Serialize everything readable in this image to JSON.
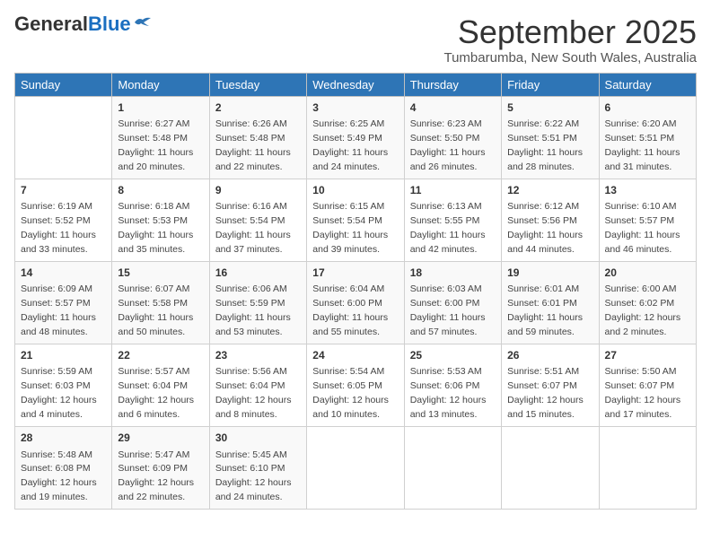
{
  "logo": {
    "general": "General",
    "blue": "Blue"
  },
  "title": "September 2025",
  "subtitle": "Tumbarumba, New South Wales, Australia",
  "days_header": [
    "Sunday",
    "Monday",
    "Tuesday",
    "Wednesday",
    "Thursday",
    "Friday",
    "Saturday"
  ],
  "weeks": [
    [
      {
        "day": "",
        "info": ""
      },
      {
        "day": "1",
        "info": "Sunrise: 6:27 AM\nSunset: 5:48 PM\nDaylight: 11 hours\nand 20 minutes."
      },
      {
        "day": "2",
        "info": "Sunrise: 6:26 AM\nSunset: 5:48 PM\nDaylight: 11 hours\nand 22 minutes."
      },
      {
        "day": "3",
        "info": "Sunrise: 6:25 AM\nSunset: 5:49 PM\nDaylight: 11 hours\nand 24 minutes."
      },
      {
        "day": "4",
        "info": "Sunrise: 6:23 AM\nSunset: 5:50 PM\nDaylight: 11 hours\nand 26 minutes."
      },
      {
        "day": "5",
        "info": "Sunrise: 6:22 AM\nSunset: 5:51 PM\nDaylight: 11 hours\nand 28 minutes."
      },
      {
        "day": "6",
        "info": "Sunrise: 6:20 AM\nSunset: 5:51 PM\nDaylight: 11 hours\nand 31 minutes."
      }
    ],
    [
      {
        "day": "7",
        "info": "Sunrise: 6:19 AM\nSunset: 5:52 PM\nDaylight: 11 hours\nand 33 minutes."
      },
      {
        "day": "8",
        "info": "Sunrise: 6:18 AM\nSunset: 5:53 PM\nDaylight: 11 hours\nand 35 minutes."
      },
      {
        "day": "9",
        "info": "Sunrise: 6:16 AM\nSunset: 5:54 PM\nDaylight: 11 hours\nand 37 minutes."
      },
      {
        "day": "10",
        "info": "Sunrise: 6:15 AM\nSunset: 5:54 PM\nDaylight: 11 hours\nand 39 minutes."
      },
      {
        "day": "11",
        "info": "Sunrise: 6:13 AM\nSunset: 5:55 PM\nDaylight: 11 hours\nand 42 minutes."
      },
      {
        "day": "12",
        "info": "Sunrise: 6:12 AM\nSunset: 5:56 PM\nDaylight: 11 hours\nand 44 minutes."
      },
      {
        "day": "13",
        "info": "Sunrise: 6:10 AM\nSunset: 5:57 PM\nDaylight: 11 hours\nand 46 minutes."
      }
    ],
    [
      {
        "day": "14",
        "info": "Sunrise: 6:09 AM\nSunset: 5:57 PM\nDaylight: 11 hours\nand 48 minutes."
      },
      {
        "day": "15",
        "info": "Sunrise: 6:07 AM\nSunset: 5:58 PM\nDaylight: 11 hours\nand 50 minutes."
      },
      {
        "day": "16",
        "info": "Sunrise: 6:06 AM\nSunset: 5:59 PM\nDaylight: 11 hours\nand 53 minutes."
      },
      {
        "day": "17",
        "info": "Sunrise: 6:04 AM\nSunset: 6:00 PM\nDaylight: 11 hours\nand 55 minutes."
      },
      {
        "day": "18",
        "info": "Sunrise: 6:03 AM\nSunset: 6:00 PM\nDaylight: 11 hours\nand 57 minutes."
      },
      {
        "day": "19",
        "info": "Sunrise: 6:01 AM\nSunset: 6:01 PM\nDaylight: 11 hours\nand 59 minutes."
      },
      {
        "day": "20",
        "info": "Sunrise: 6:00 AM\nSunset: 6:02 PM\nDaylight: 12 hours\nand 2 minutes."
      }
    ],
    [
      {
        "day": "21",
        "info": "Sunrise: 5:59 AM\nSunset: 6:03 PM\nDaylight: 12 hours\nand 4 minutes."
      },
      {
        "day": "22",
        "info": "Sunrise: 5:57 AM\nSunset: 6:04 PM\nDaylight: 12 hours\nand 6 minutes."
      },
      {
        "day": "23",
        "info": "Sunrise: 5:56 AM\nSunset: 6:04 PM\nDaylight: 12 hours\nand 8 minutes."
      },
      {
        "day": "24",
        "info": "Sunrise: 5:54 AM\nSunset: 6:05 PM\nDaylight: 12 hours\nand 10 minutes."
      },
      {
        "day": "25",
        "info": "Sunrise: 5:53 AM\nSunset: 6:06 PM\nDaylight: 12 hours\nand 13 minutes."
      },
      {
        "day": "26",
        "info": "Sunrise: 5:51 AM\nSunset: 6:07 PM\nDaylight: 12 hours\nand 15 minutes."
      },
      {
        "day": "27",
        "info": "Sunrise: 5:50 AM\nSunset: 6:07 PM\nDaylight: 12 hours\nand 17 minutes."
      }
    ],
    [
      {
        "day": "28",
        "info": "Sunrise: 5:48 AM\nSunset: 6:08 PM\nDaylight: 12 hours\nand 19 minutes."
      },
      {
        "day": "29",
        "info": "Sunrise: 5:47 AM\nSunset: 6:09 PM\nDaylight: 12 hours\nand 22 minutes."
      },
      {
        "day": "30",
        "info": "Sunrise: 5:45 AM\nSunset: 6:10 PM\nDaylight: 12 hours\nand 24 minutes."
      },
      {
        "day": "",
        "info": ""
      },
      {
        "day": "",
        "info": ""
      },
      {
        "day": "",
        "info": ""
      },
      {
        "day": "",
        "info": ""
      }
    ]
  ]
}
